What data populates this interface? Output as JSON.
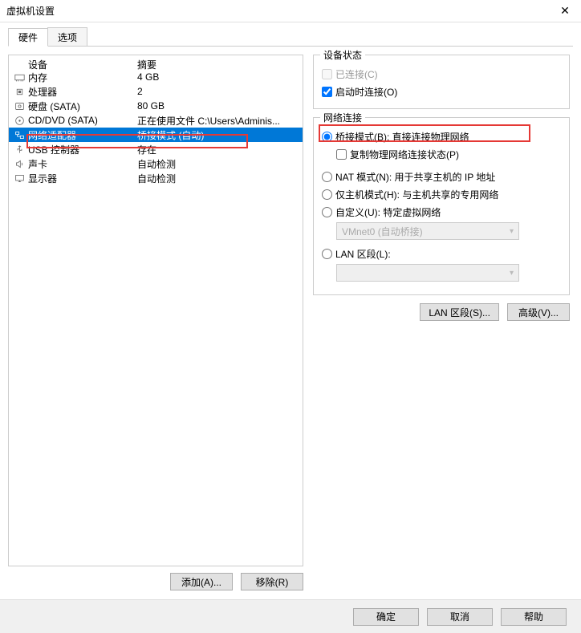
{
  "window": {
    "title": "虚拟机设置"
  },
  "tabs": {
    "hardware": "硬件",
    "options": "选项"
  },
  "columns": {
    "device": "设备",
    "summary": "摘要"
  },
  "devices": [
    {
      "name": "内存",
      "summary": "4 GB",
      "icon": "memory"
    },
    {
      "name": "处理器",
      "summary": "2",
      "icon": "cpu"
    },
    {
      "name": "硬盘 (SATA)",
      "summary": "80 GB",
      "icon": "disk"
    },
    {
      "name": "CD/DVD (SATA)",
      "summary": "正在使用文件 C:\\Users\\Adminis...",
      "icon": "cd"
    },
    {
      "name": "网络适配器",
      "summary": "桥接模式 (自动)",
      "icon": "network",
      "selected": true
    },
    {
      "name": "USB 控制器",
      "summary": "存在",
      "icon": "usb"
    },
    {
      "name": "声卡",
      "summary": "自动检测",
      "icon": "sound"
    },
    {
      "name": "显示器",
      "summary": "自动检测",
      "icon": "display"
    }
  ],
  "left_buttons": {
    "add": "添加(A)...",
    "remove": "移除(R)"
  },
  "status_group": {
    "title": "设备状态",
    "connected": "已连接(C)",
    "connect_at_poweron": "启动时连接(O)"
  },
  "network_group": {
    "title": "网络连接",
    "bridged": "桥接模式(B): 直接连接物理网络",
    "replicate": "复制物理网络连接状态(P)",
    "nat": "NAT 模式(N): 用于共享主机的 IP 地址",
    "hostonly": "仅主机模式(H): 与主机共享的专用网络",
    "custom": "自定义(U): 特定虚拟网络",
    "custom_value": "VMnet0 (自动桥接)",
    "lan_segment": "LAN 区段(L):",
    "lan_value": ""
  },
  "right_buttons": {
    "lan_segments": "LAN 区段(S)...",
    "advanced": "高级(V)..."
  },
  "bottom": {
    "ok": "确定",
    "cancel": "取消",
    "help": "帮助"
  }
}
